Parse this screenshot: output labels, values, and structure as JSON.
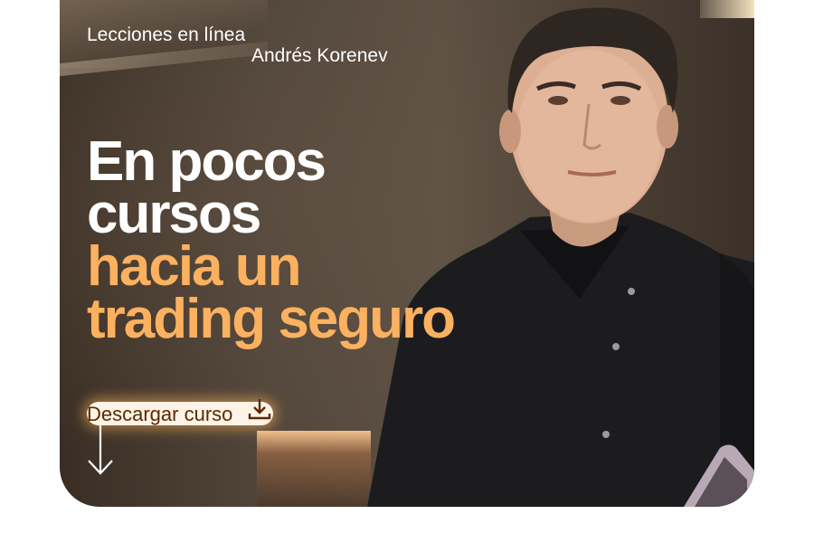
{
  "banner": {
    "topline": "Lecciones en línea",
    "author": "Andrés Korenev",
    "headline_white": [
      "En pocos",
      "cursos"
    ],
    "headline_orange": [
      "hacia un",
      "trading seguro"
    ],
    "cta_label": "Descargar curso"
  },
  "colors": {
    "accent_orange": "#fbb160",
    "cta_background": "#fdf3e6",
    "cta_text": "#5a2a06"
  },
  "icons": {
    "cta_icon": "download-icon",
    "arrow": "arrow-down-icon"
  }
}
